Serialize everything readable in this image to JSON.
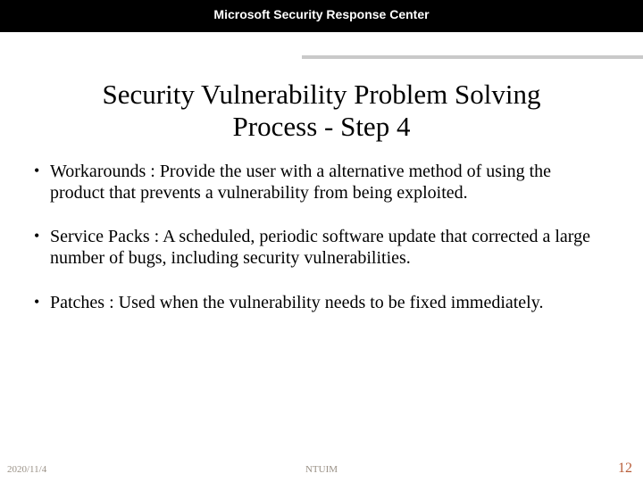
{
  "header": {
    "title": "Microsoft Security Response Center"
  },
  "slide": {
    "title_line1": "Security Vulnerability Problem Solving",
    "title_line2": "Process - Step 4",
    "bullets": [
      "Workarounds : Provide the user with a alternative method of using the product that prevents a vulnerability from being exploited.",
      "Service Packs : A scheduled, periodic software update that corrected a large number of bugs, including security vulnerabilities.",
      "Patches : Used when the vulnerability needs to be fixed immediately."
    ]
  },
  "footer": {
    "date": "2020/11/4",
    "center": "NTUIM",
    "page": "12"
  }
}
